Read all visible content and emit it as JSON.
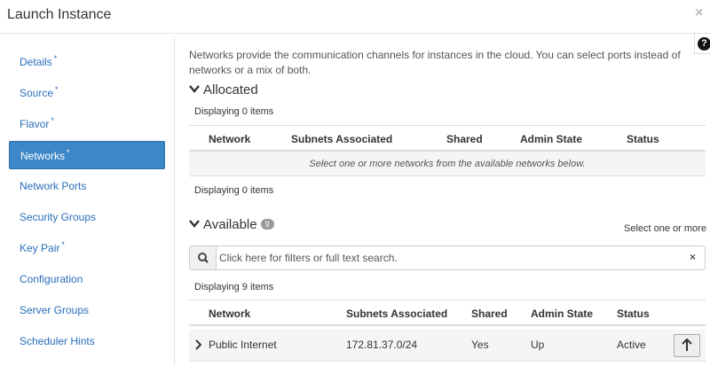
{
  "header": {
    "title": "Launch Instance",
    "close_label": "×"
  },
  "help": {
    "label": "?"
  },
  "sidebar": {
    "items": [
      {
        "label": "Details",
        "required": "*"
      },
      {
        "label": "Source",
        "required": "*"
      },
      {
        "label": "Flavor",
        "required": "*"
      },
      {
        "label": "Networks",
        "required": "*"
      },
      {
        "label": "Network Ports",
        "required": ""
      },
      {
        "label": "Security Groups",
        "required": ""
      },
      {
        "label": "Key Pair",
        "required": "*"
      },
      {
        "label": "Configuration",
        "required": ""
      },
      {
        "label": "Server Groups",
        "required": ""
      },
      {
        "label": "Scheduler Hints",
        "required": ""
      }
    ],
    "active": "Networks"
  },
  "main": {
    "intro": "Networks provide the communication channels for instances in the cloud. You can select ports instead of networks or a mix of both.",
    "allocated": {
      "title": "Allocated",
      "count_top": "Displaying 0 items",
      "count_bottom": "Displaying 0 items",
      "columns": [
        "Network",
        "Subnets Associated",
        "Shared",
        "Admin State",
        "Status"
      ],
      "empty_text": "Select one or more networks from the available networks below."
    },
    "available": {
      "title": "Available",
      "badge": "9",
      "hint": "Select one or more",
      "search_placeholder": "Click here for filters or full text search.",
      "clear_label": "×",
      "count": "Displaying 9 items",
      "columns": [
        "Network",
        "Subnets Associated",
        "Shared",
        "Admin State",
        "Status"
      ],
      "rows": [
        {
          "network": "Public Internet",
          "subnets": "172.81.37.0/24",
          "shared": "Yes",
          "admin_state": "Up",
          "status": "Active"
        }
      ]
    }
  },
  "colors": {
    "accent": "#3d87c9",
    "link": "#2a6ebb"
  },
  "icons": {
    "help": "question-circle-icon",
    "close": "close-icon",
    "search": "search-icon",
    "chevron": "chevron-down-icon",
    "expand": "chevron-right-icon",
    "add": "arrow-up-icon"
  }
}
